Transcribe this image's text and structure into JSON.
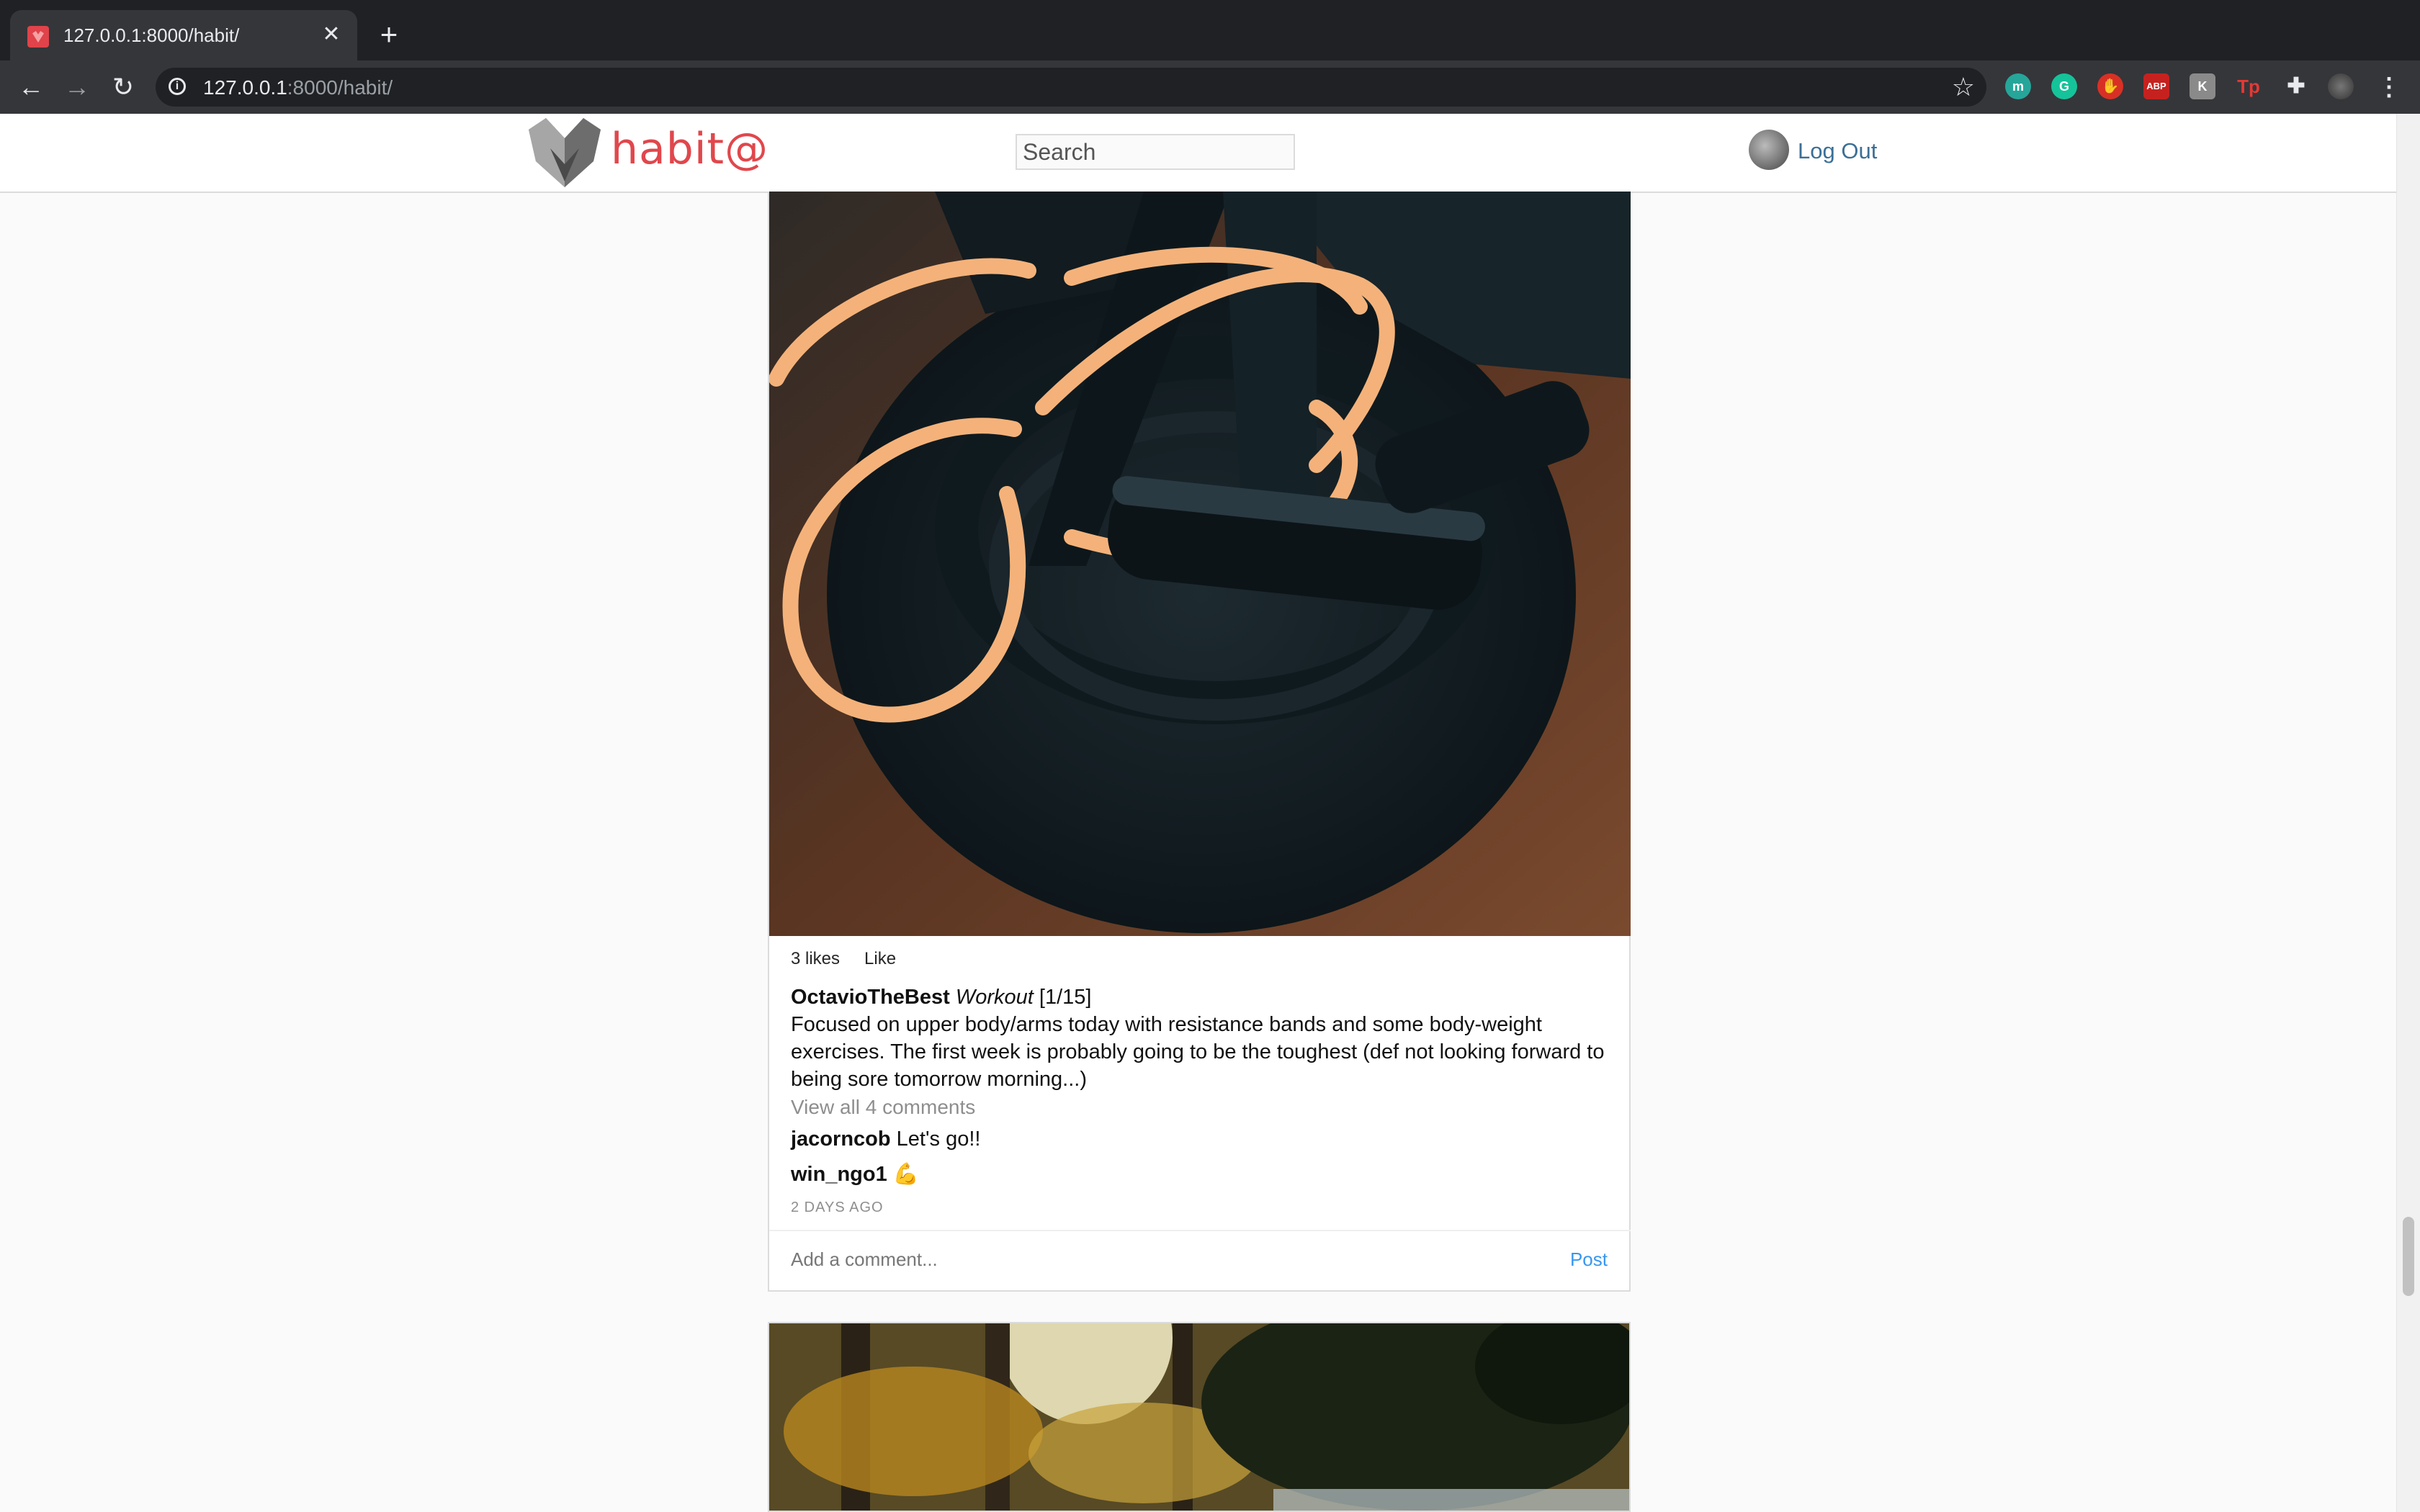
{
  "browser": {
    "tab_title": "127.0.0.1:8000/habit/",
    "url_host": "127.0.0.1",
    "url_rest": ":8000/habit/"
  },
  "header": {
    "brand": "habit@",
    "search_placeholder": "Search",
    "logout_label": "Log Out"
  },
  "post": {
    "likes": "3 likes",
    "like_label": "Like",
    "author": "OctavioTheBest",
    "habit": "Workout",
    "progress": "[1/15]",
    "caption": "Focused on upper body/arms today with resistance bands and some body-weight exercises. The first week is probably going to be the toughest (def not looking forward to being sore tomorrow morning...)",
    "view_all": "View all 4 comments",
    "comments": [
      {
        "user": "jacorncob",
        "text": "Let's go!!"
      },
      {
        "user": "win_ngo1",
        "text": "💪"
      }
    ],
    "timestamp": "2 DAYS AGO",
    "comment_placeholder": "Add a comment...",
    "post_label": "Post"
  },
  "extensions": [
    "m",
    "G",
    "✋",
    "ABP",
    "K",
    "Tp"
  ],
  "colors": {
    "brand": "#e0474c",
    "link": "#3b6f96",
    "post_button": "#3897f0"
  }
}
